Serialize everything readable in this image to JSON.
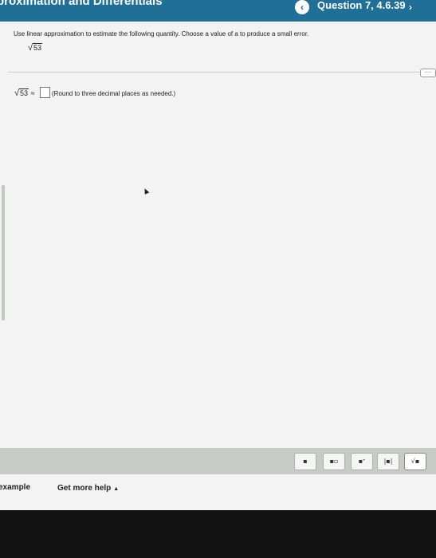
{
  "header": {
    "title": "proximation and Differentials",
    "prev_icon": "‹",
    "question_label": "Question 7, 4.6.39",
    "next_icon": "›"
  },
  "problem": {
    "instruction": "Use linear approximation to estimate the following quantity. Choose a value of a to produce a small error.",
    "radicand": "53",
    "answer_prefix_radicand": "53",
    "approx_symbol": "≈",
    "answer_value": "",
    "round_note": "(Round to three decimal places as needed.)",
    "more_button_label": "....."
  },
  "toolbar": {
    "buttons": [
      {
        "icon": "fraction-template-icon",
        "glyph": "▪"
      },
      {
        "icon": "mixed-number-template-icon",
        "glyph": "▪▫"
      },
      {
        "icon": "exponent-template-icon",
        "glyph": "▪ᐩ"
      },
      {
        "icon": "absolute-value-template-icon",
        "glyph": "|▪|"
      },
      {
        "icon": "square-root-template-icon",
        "glyph": "√▪"
      }
    ]
  },
  "footer": {
    "view_example": "example",
    "get_more_help": "Get more help",
    "help_caret": "▲"
  }
}
